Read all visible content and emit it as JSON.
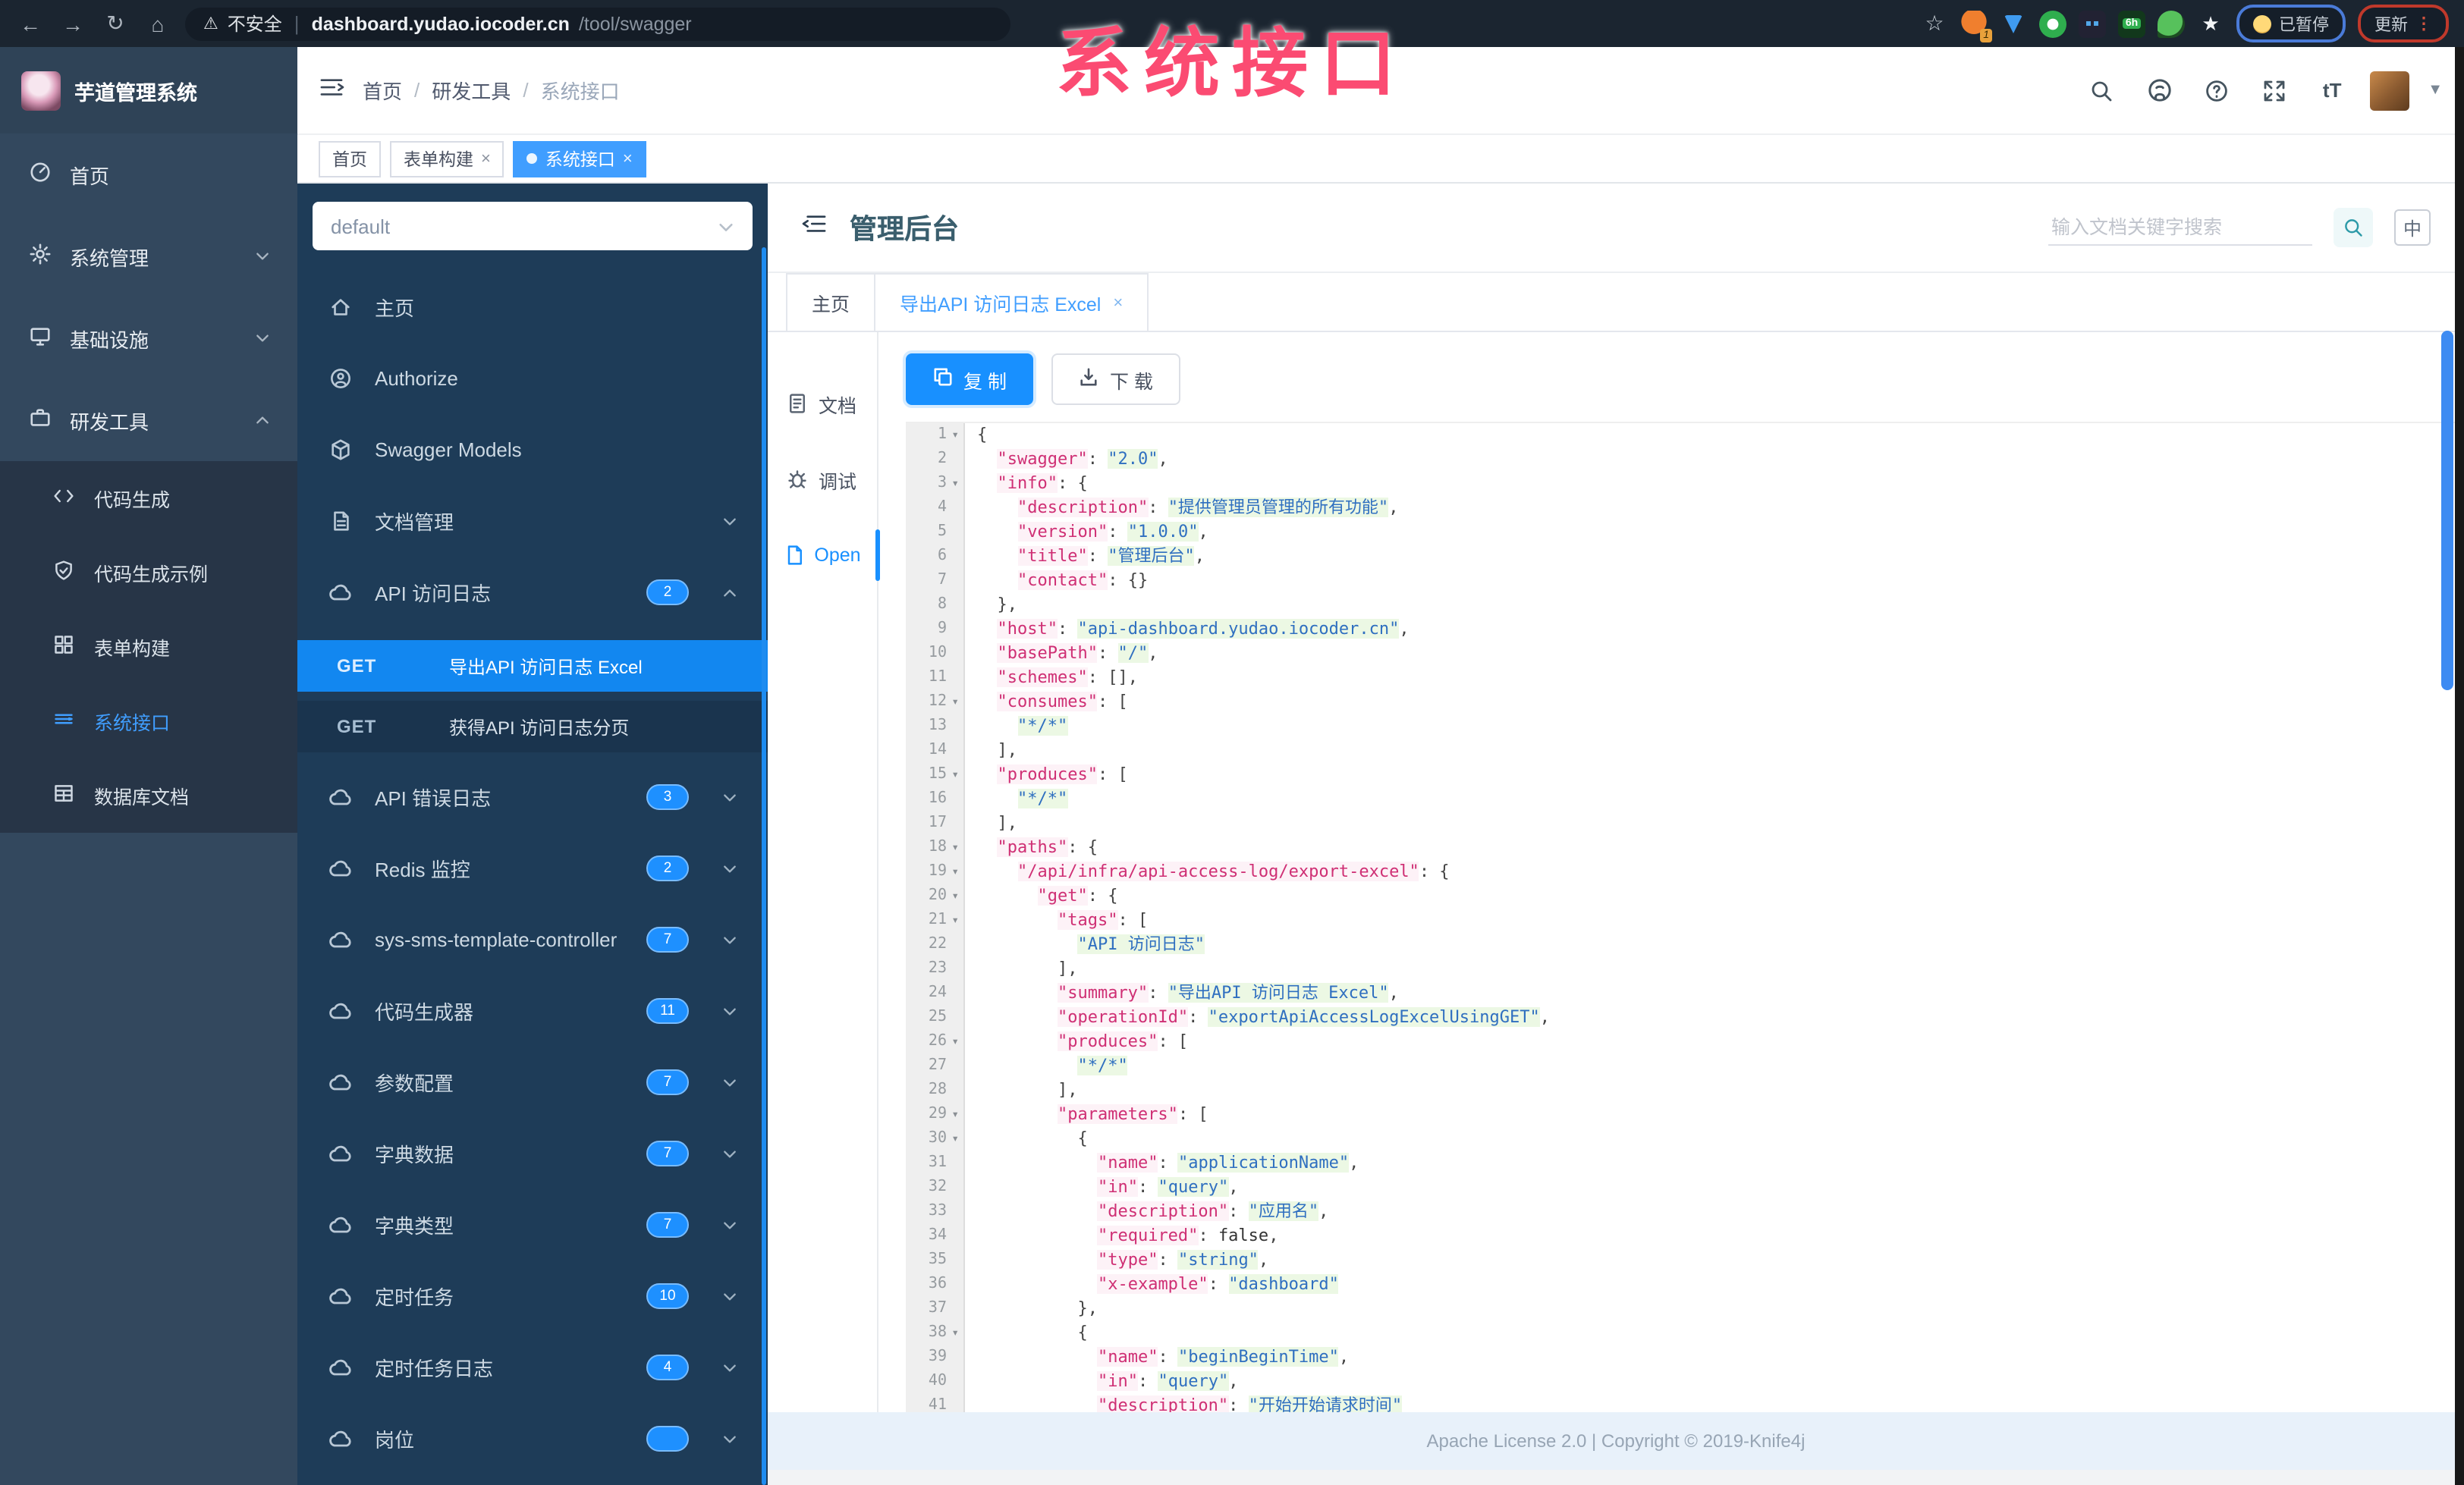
{
  "browser": {
    "back_glyph": "←",
    "forward_glyph": "→",
    "reload_glyph": "↻",
    "home_glyph": "⌂",
    "warn_glyph": "⚠",
    "security_label": "不安全",
    "url_host": "dashboard.yudao.iocoder.cn",
    "url_path": "/tool/swagger",
    "star_glyph": "☆",
    "ext_badge": "1",
    "ext_6h": "6h",
    "paused_label": "已暂停",
    "update_label": "更新",
    "dots_glyph": "⋮"
  },
  "annotation": {
    "text": "系统接口",
    "color": "#fb4b72"
  },
  "app": {
    "logo_title": "芋道管理系统",
    "breadcrumb": {
      "0": "首页",
      "1": "研发工具",
      "2": "系统接口",
      "sep": "/"
    },
    "tags": {
      "0": {
        "label": "首页"
      },
      "1": {
        "label": "表单构建",
        "close": "×"
      },
      "2": {
        "label": "系统接口",
        "close": "×"
      }
    },
    "sidebar": {
      "0": {
        "label": "首页"
      },
      "1": {
        "label": "系统管理"
      },
      "2": {
        "label": "基础设施"
      },
      "3": {
        "label": "研发工具"
      }
    },
    "submenu": {
      "0": {
        "label": "代码生成"
      },
      "1": {
        "label": "代码生成示例"
      },
      "2": {
        "label": "表单构建"
      },
      "3": {
        "label": "系统接口"
      },
      "4": {
        "label": "数据库文档"
      }
    }
  },
  "swagger": {
    "project_select": "default",
    "nav": {
      "0": {
        "label": "主页"
      },
      "1": {
        "label": "Authorize"
      },
      "2": {
        "label": "Swagger Models"
      },
      "3": {
        "label": "文档管理"
      },
      "4": {
        "label": "API 访问日志",
        "count": "2"
      }
    },
    "operations": [
      {
        "method": "GET",
        "label": "导出API 访问日志 Excel",
        "active": true
      },
      {
        "method": "GET",
        "label": "获得API 访问日志分页",
        "active": false
      }
    ],
    "groups": [
      {
        "label": "API 错误日志",
        "count": "3"
      },
      {
        "label": "Redis 监控",
        "count": "2"
      },
      {
        "label": "sys-sms-template-controller",
        "count": "7"
      },
      {
        "label": "代码生成器",
        "count": "11"
      },
      {
        "label": "参数配置",
        "count": "7"
      },
      {
        "label": "字典数据",
        "count": "7"
      },
      {
        "label": "字典类型",
        "count": "7"
      },
      {
        "label": "定时任务",
        "count": "10"
      },
      {
        "label": "定时任务日志",
        "count": "4"
      },
      {
        "label": "岗位",
        "count": ""
      }
    ]
  },
  "content": {
    "title": "管理后台",
    "search_placeholder": "输入文档关键字搜索",
    "lang_label": "中",
    "tabs": {
      "0": {
        "label": "主页"
      },
      "1": {
        "label": "导出API 访问日志 Excel",
        "close": "×"
      }
    },
    "side_tabs": {
      "0": {
        "label": "文档"
      },
      "1": {
        "label": "调试"
      },
      "2": {
        "label": "Open"
      }
    },
    "copy_label": "复 制",
    "download_label": "下 载",
    "footer": "Apache License 2.0 | Copyright © 2019-Knife4j"
  },
  "editor": {
    "fold_glyph": "▾",
    "fold_lines": [
      1,
      3,
      12,
      15,
      18,
      19,
      20,
      21,
      26,
      29,
      30,
      38
    ],
    "lines": [
      [
        [
          "p",
          "{"
        ]
      ],
      [
        [
          "p",
          "  "
        ],
        [
          "k",
          "\"swagger\""
        ],
        [
          "p",
          ": "
        ],
        [
          "s",
          "\"2.0\""
        ],
        [
          "p",
          ","
        ]
      ],
      [
        [
          "p",
          "  "
        ],
        [
          "k",
          "\"info\""
        ],
        [
          "p",
          ": {"
        ]
      ],
      [
        [
          "p",
          "    "
        ],
        [
          "k",
          "\"description\""
        ],
        [
          "p",
          ": "
        ],
        [
          "s",
          "\"提供管理员管理的所有功能\""
        ],
        [
          "p",
          ","
        ]
      ],
      [
        [
          "p",
          "    "
        ],
        [
          "k",
          "\"version\""
        ],
        [
          "p",
          ": "
        ],
        [
          "s",
          "\"1.0.0\""
        ],
        [
          "p",
          ","
        ]
      ],
      [
        [
          "p",
          "    "
        ],
        [
          "k",
          "\"title\""
        ],
        [
          "p",
          ": "
        ],
        [
          "s",
          "\"管理后台\""
        ],
        [
          "p",
          ","
        ]
      ],
      [
        [
          "p",
          "    "
        ],
        [
          "k",
          "\"contact\""
        ],
        [
          "p",
          ": {}"
        ]
      ],
      [
        [
          "p",
          "  },"
        ]
      ],
      [
        [
          "p",
          "  "
        ],
        [
          "k",
          "\"host\""
        ],
        [
          "p",
          ": "
        ],
        [
          "s",
          "\"api-dashboard.yudao.iocoder.cn\""
        ],
        [
          "p",
          ","
        ]
      ],
      [
        [
          "p",
          "  "
        ],
        [
          "k",
          "\"basePath\""
        ],
        [
          "p",
          ": "
        ],
        [
          "s",
          "\"/\""
        ],
        [
          "p",
          ","
        ]
      ],
      [
        [
          "p",
          "  "
        ],
        [
          "k",
          "\"schemes\""
        ],
        [
          "p",
          ": [],"
        ]
      ],
      [
        [
          "p",
          "  "
        ],
        [
          "k",
          "\"consumes\""
        ],
        [
          "p",
          ": ["
        ]
      ],
      [
        [
          "p",
          "    "
        ],
        [
          "s",
          "\"*/*\""
        ]
      ],
      [
        [
          "p",
          "  ],"
        ]
      ],
      [
        [
          "p",
          "  "
        ],
        [
          "k",
          "\"produces\""
        ],
        [
          "p",
          ": ["
        ]
      ],
      [
        [
          "p",
          "    "
        ],
        [
          "s",
          "\"*/*\""
        ]
      ],
      [
        [
          "p",
          "  ],"
        ]
      ],
      [
        [
          "p",
          "  "
        ],
        [
          "k",
          "\"paths\""
        ],
        [
          "p",
          ": {"
        ]
      ],
      [
        [
          "p",
          "    "
        ],
        [
          "k",
          "\"/api/infra/api-access-log/export-excel\""
        ],
        [
          "p",
          ": {"
        ]
      ],
      [
        [
          "p",
          "      "
        ],
        [
          "k",
          "\"get\""
        ],
        [
          "p",
          ": {"
        ]
      ],
      [
        [
          "p",
          "        "
        ],
        [
          "k",
          "\"tags\""
        ],
        [
          "p",
          ": ["
        ]
      ],
      [
        [
          "p",
          "          "
        ],
        [
          "s",
          "\"API 访问日志\""
        ]
      ],
      [
        [
          "p",
          "        ],"
        ]
      ],
      [
        [
          "p",
          "        "
        ],
        [
          "k",
          "\"summary\""
        ],
        [
          "p",
          ": "
        ],
        [
          "s",
          "\"导出API 访问日志 Excel\""
        ],
        [
          "p",
          ","
        ]
      ],
      [
        [
          "p",
          "        "
        ],
        [
          "k",
          "\"operationId\""
        ],
        [
          "p",
          ": "
        ],
        [
          "s",
          "\"exportApiAccessLogExcelUsingGET\""
        ],
        [
          "p",
          ","
        ]
      ],
      [
        [
          "p",
          "        "
        ],
        [
          "k",
          "\"produces\""
        ],
        [
          "p",
          ": ["
        ]
      ],
      [
        [
          "p",
          "          "
        ],
        [
          "s",
          "\"*/*\""
        ]
      ],
      [
        [
          "p",
          "        ],"
        ]
      ],
      [
        [
          "p",
          "        "
        ],
        [
          "k",
          "\"parameters\""
        ],
        [
          "p",
          ": ["
        ]
      ],
      [
        [
          "p",
          "          {"
        ]
      ],
      [
        [
          "p",
          "            "
        ],
        [
          "k",
          "\"name\""
        ],
        [
          "p",
          ": "
        ],
        [
          "s",
          "\"applicationName\""
        ],
        [
          "p",
          ","
        ]
      ],
      [
        [
          "p",
          "            "
        ],
        [
          "k",
          "\"in\""
        ],
        [
          "p",
          ": "
        ],
        [
          "s",
          "\"query\""
        ],
        [
          "p",
          ","
        ]
      ],
      [
        [
          "p",
          "            "
        ],
        [
          "k",
          "\"description\""
        ],
        [
          "p",
          ": "
        ],
        [
          "s",
          "\"应用名\""
        ],
        [
          "p",
          ","
        ]
      ],
      [
        [
          "p",
          "            "
        ],
        [
          "k",
          "\"required\""
        ],
        [
          "p",
          ": "
        ],
        [
          "b",
          "false"
        ],
        [
          "p",
          ","
        ]
      ],
      [
        [
          "p",
          "            "
        ],
        [
          "k",
          "\"type\""
        ],
        [
          "p",
          ": "
        ],
        [
          "s",
          "\"string\""
        ],
        [
          "p",
          ","
        ]
      ],
      [
        [
          "p",
          "            "
        ],
        [
          "k",
          "\"x-example\""
        ],
        [
          "p",
          ": "
        ],
        [
          "s",
          "\"dashboard\""
        ]
      ],
      [
        [
          "p",
          "          },"
        ]
      ],
      [
        [
          "p",
          "          {"
        ]
      ],
      [
        [
          "p",
          "            "
        ],
        [
          "k",
          "\"name\""
        ],
        [
          "p",
          ": "
        ],
        [
          "s",
          "\"beginBeginTime\""
        ],
        [
          "p",
          ","
        ]
      ],
      [
        [
          "p",
          "            "
        ],
        [
          "k",
          "\"in\""
        ],
        [
          "p",
          ": "
        ],
        [
          "s",
          "\"query\""
        ],
        [
          "p",
          ","
        ]
      ],
      [
        [
          "p",
          "            "
        ],
        [
          "k",
          "\"description\""
        ],
        [
          "p",
          ": "
        ],
        [
          "s",
          "\"开始开始请求时间\""
        ]
      ]
    ]
  }
}
